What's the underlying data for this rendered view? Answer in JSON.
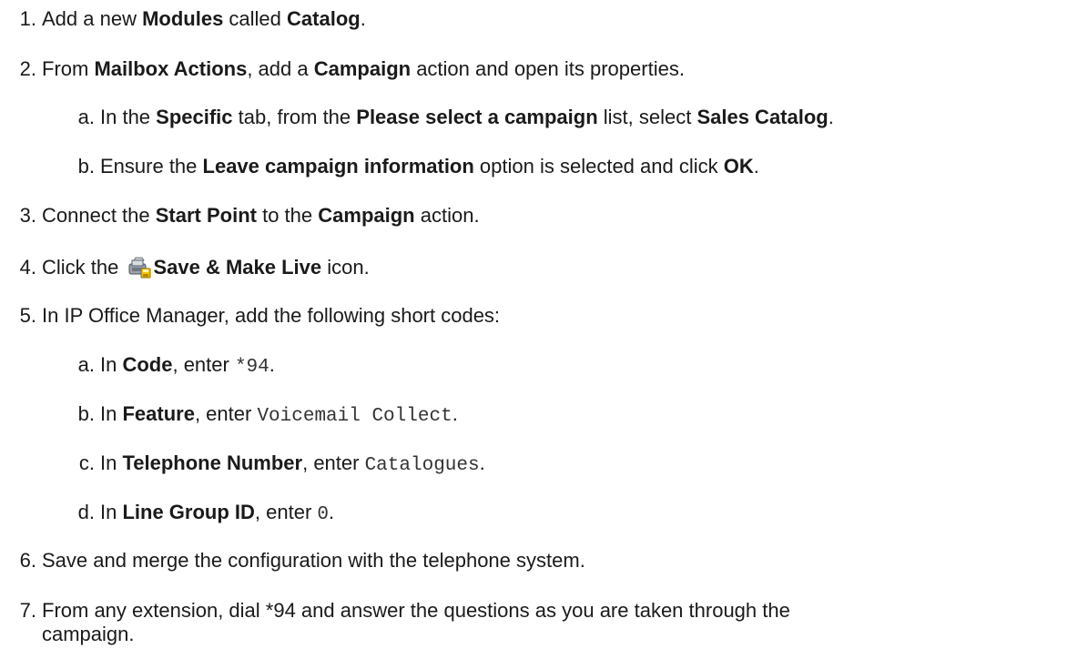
{
  "steps": [
    {
      "num": "1.",
      "t1": "Add a new ",
      "b1": "Modules",
      "t2": " called ",
      "b2": "Catalog",
      "t3": "."
    },
    {
      "num": "2.",
      "t1": "From ",
      "b1": "Mailbox Actions",
      "t2": ", add a ",
      "b2": "Campaign",
      "t3": " action and open its properties."
    },
    {
      "num": "a.",
      "t1": "In the ",
      "b1": "Specific",
      "t2": " tab, from the ",
      "b2": "Please select a campaign",
      "t3": " list, select ",
      "b3": "Sales Catalog",
      "t4": "."
    },
    {
      "num": "b.",
      "t1": "Ensure the ",
      "b1": "Leave campaign information",
      "t2": " option is selected and click ",
      "b2": "OK",
      "t3": "."
    },
    {
      "num": "3.",
      "t1": "Connect the ",
      "b1": "Start Point",
      "t2": " to the ",
      "b2": "Campaign",
      "t3": " action."
    },
    {
      "num": "4.",
      "t1": "Click the ",
      "icon": "save-make-live-icon",
      "b1": "Save & Make Live",
      "t2": " icon."
    },
    {
      "num": "5.",
      "t1": "In IP Office Manager, add the following short codes:"
    },
    {
      "num": "a.",
      "t1": "In ",
      "b1": "Code",
      "t2": ", enter ",
      "m1": "*94",
      "t3": "."
    },
    {
      "num": "b.",
      "t1": "In ",
      "b1": "Feature",
      "t2": ", enter ",
      "m1": "Voicemail Collect",
      "t3": "."
    },
    {
      "num": "c.",
      "t1": "In ",
      "b1": "Telephone Number",
      "t2": ", enter ",
      "m1": "Catalogues",
      "t3": "."
    },
    {
      "num": "d.",
      "t1": "In ",
      "b1": "Line Group ID",
      "t2": ", enter ",
      "m1": "0",
      "t3": "."
    },
    {
      "num": "6.",
      "t1": "Save and merge the configuration with the telephone system."
    },
    {
      "num": "7.",
      "t1": "From any extension, dial *94 and answer the questions as you are taken through the",
      "t2": "campaign."
    }
  ]
}
